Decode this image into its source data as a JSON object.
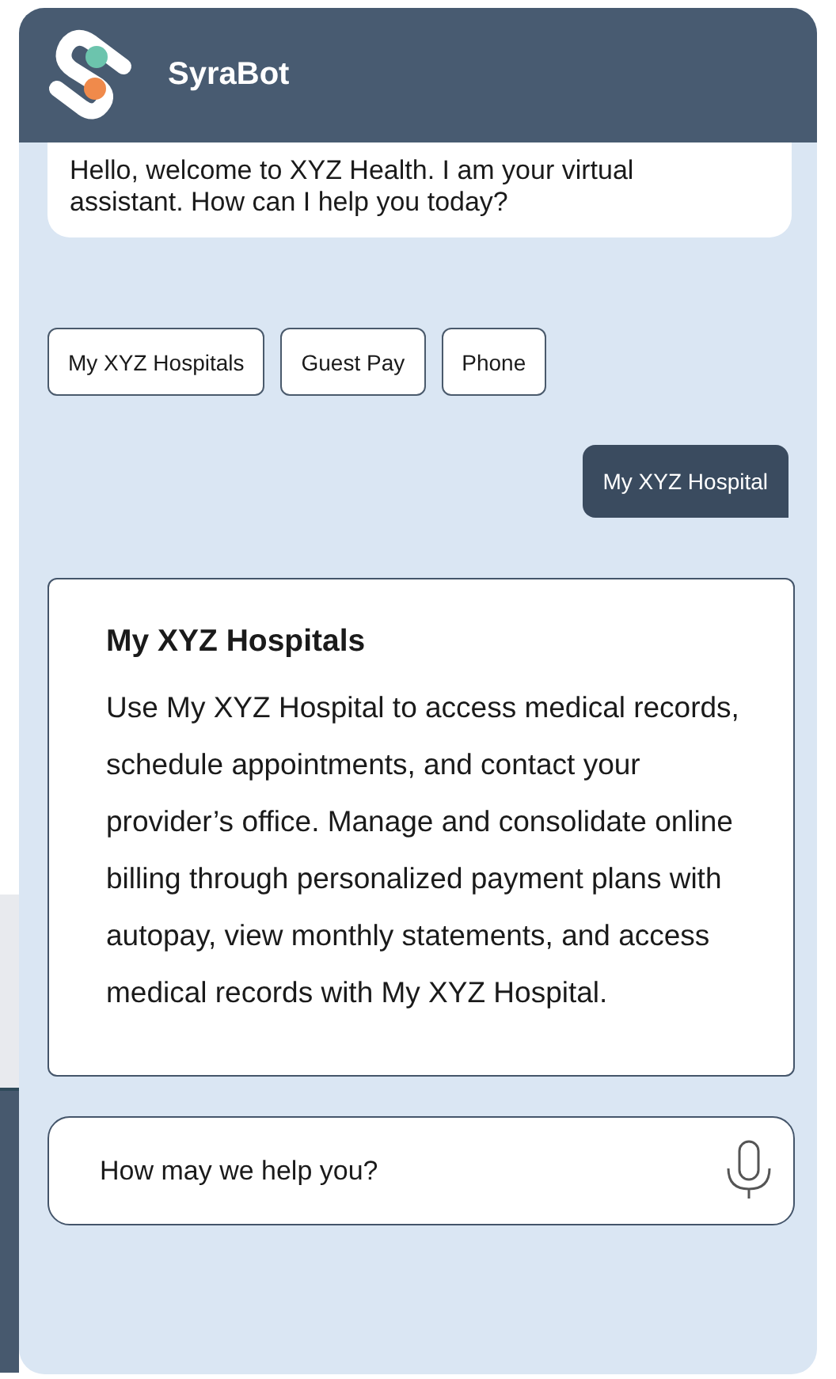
{
  "header": {
    "title": "SyraBot"
  },
  "messages": [
    {
      "kind": "bot",
      "text": "Hello, welcome to XYZ Health. I am your virtual assistant. How can I help you today?"
    }
  ],
  "quick_replies": [
    {
      "label": "My XYZ Hospitals"
    },
    {
      "label": "Guest Pay"
    },
    {
      "label": "Phone"
    }
  ],
  "user_message": {
    "text": "My XYZ Hospital"
  },
  "info_card": {
    "title": "My XYZ Hospitals",
    "body": "Use My XYZ Hospital to access medical records, schedule appointments, and contact your provider’s office. Manage and consolidate online billing through personalized payment plans with autopay, view monthly statements, and access medical records with My XYZ Hospital."
  },
  "input": {
    "placeholder": "How may we help you?"
  }
}
